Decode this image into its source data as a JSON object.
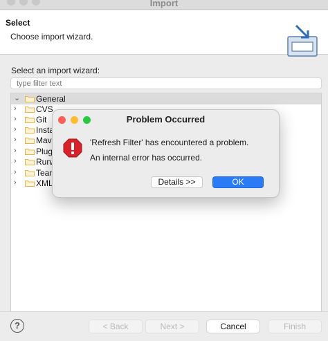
{
  "window": {
    "title": "Import"
  },
  "header": {
    "title": "Select",
    "description": "Choose import wizard."
  },
  "main": {
    "select_label": "Select an import wizard:",
    "filter_placeholder": "type filter text",
    "tree": [
      {
        "label": "General",
        "selected": true
      },
      {
        "label": "CVS"
      },
      {
        "label": "Git"
      },
      {
        "label": "Insta"
      },
      {
        "label": "Mave"
      },
      {
        "label": "Plug-"
      },
      {
        "label": "Run/I"
      },
      {
        "label": "Team"
      },
      {
        "label": "XML"
      }
    ]
  },
  "footer": {
    "help_label": "?",
    "back_label": "< Back",
    "next_label": "Next >",
    "cancel_label": "Cancel",
    "finish_label": "Finish"
  },
  "dialog": {
    "title": "Problem Occurred",
    "message": "'Refresh Filter' has encountered a problem.",
    "detail": "An internal error has occurred.",
    "details_button": "Details >>",
    "ok_button": "OK"
  },
  "colors": {
    "accent": "#2a7bf5",
    "error": "#d8222a",
    "close_dot": "#fe5f57",
    "minimize_dot": "#febc2e",
    "zoom_dot": "#28c840",
    "folder": "#e9b44c"
  },
  "icons": [
    "chevron-right-icon",
    "folder-icon",
    "error-icon",
    "help-icon",
    "import-wizard-icon"
  ]
}
